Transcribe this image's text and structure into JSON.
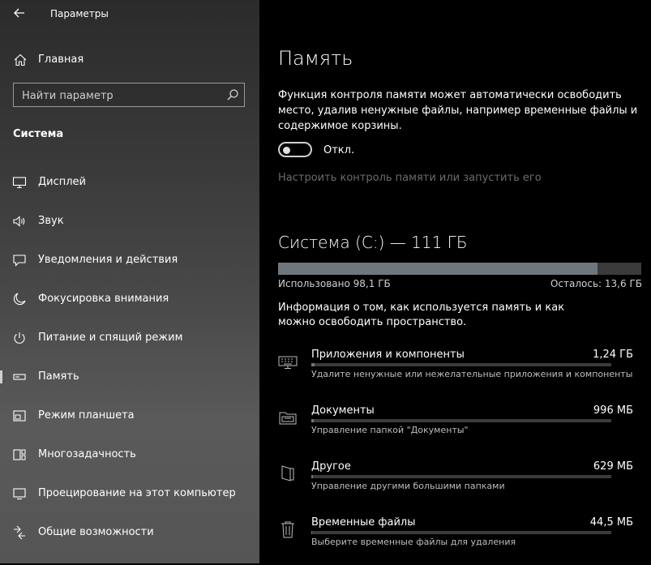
{
  "window": {
    "title": "Параметры"
  },
  "sidebar": {
    "home_label": "Главная",
    "search_placeholder": "Найти параметр",
    "section_title": "Система",
    "items": [
      {
        "label": "Дисплей",
        "icon": "display-icon"
      },
      {
        "label": "Звук",
        "icon": "speaker-icon"
      },
      {
        "label": "Уведомления и действия",
        "icon": "notification-icon"
      },
      {
        "label": "Фокусировка внимания",
        "icon": "moon-icon"
      },
      {
        "label": "Питание и спящий режим",
        "icon": "power-icon"
      },
      {
        "label": "Память",
        "icon": "storage-icon",
        "selected": true
      },
      {
        "label": "Режим планшета",
        "icon": "tablet-icon"
      },
      {
        "label": "Многозадачность",
        "icon": "multitask-icon"
      },
      {
        "label": "Проецирование на этот компьютер",
        "icon": "projector-icon"
      },
      {
        "label": "Общие возможности",
        "icon": "shared-icon"
      }
    ]
  },
  "main": {
    "title": "Память",
    "description": "Функция контроля памяти может автоматически освободить место, удалив ненужные файлы, например временные файлы и содержимое корзины.",
    "toggle": {
      "state": "off",
      "label": "Откл."
    },
    "config_link": "Настроить контроль памяти или запустить его",
    "drive": {
      "title": "Система (C:) — 111 ГБ",
      "used_fraction": 0.88,
      "used_label": "Использовано 98,1 ГБ",
      "free_label": "Осталось: 13,6 ГБ"
    },
    "info": "Информация о том, как используется память и как можно освободить пространство.",
    "categories": [
      {
        "name": "Приложения и компоненты",
        "size": "1,24 ГБ",
        "sub": "Удалите ненужные или нежелательные приложения и компоненты",
        "fraction": 0.01,
        "icon": "keyboard-icon"
      },
      {
        "name": "Документы",
        "size": "996 МБ",
        "sub": "Управление папкой \"Документы\"",
        "fraction": 0.008,
        "icon": "folder-icon"
      },
      {
        "name": "Другое",
        "size": "629 МБ",
        "sub": "Управление другими большими папками",
        "fraction": 0.005,
        "icon": "other-folder-icon"
      },
      {
        "name": "Временные файлы",
        "size": "44,5 МБ",
        "sub": "Выберите временные файлы для удаления",
        "fraction": 0.001,
        "icon": "trash-icon"
      }
    ]
  },
  "colors": {
    "accent_bar": "#6f777e",
    "bar_bg": "#3b3b3b",
    "disabled_text": "#6b6b6b"
  }
}
